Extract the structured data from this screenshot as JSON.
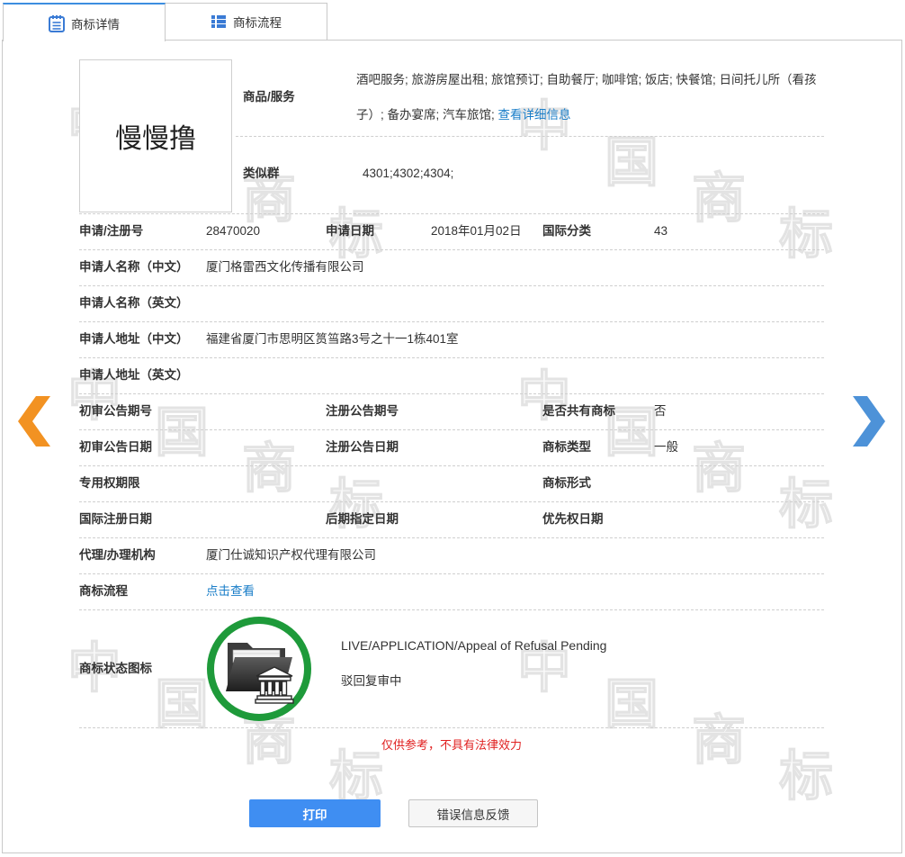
{
  "tabs": [
    {
      "label": "商标详情",
      "icon": "notebook-icon",
      "active": true
    },
    {
      "label": "商标流程",
      "icon": "list-icon",
      "active": false
    }
  ],
  "trademark": {
    "image_text": "慢慢撸"
  },
  "goods_services": {
    "label": "商品/服务",
    "value": "酒吧服务; 旅游房屋出租; 旅馆预订; 自助餐厅; 咖啡馆; 饭店; 快餐馆; 日间托儿所（看孩子）; 备办宴席; 汽车旅馆;",
    "detail_link": "查看详细信息"
  },
  "similar_group": {
    "label": "类似群",
    "value": "4301;4302;4304;"
  },
  "details": {
    "registration_no": {
      "label": "申请/注册号",
      "value": "28470020"
    },
    "application_date": {
      "label": "申请日期",
      "value": "2018年01月02日"
    },
    "international_class": {
      "label": "国际分类",
      "value": "43"
    },
    "applicant_name_cn": {
      "label": "申请人名称（中文）",
      "value": "厦门格雷西文化传播有限公司"
    },
    "applicant_name_en": {
      "label": "申请人名称（英文）"
    },
    "applicant_address_cn": {
      "label": "申请人地址（中文）",
      "value": "福建省厦门市思明区筼筜路3号之十一1栋401室"
    },
    "applicant_address_en": {
      "label": "申请人地址（英文）"
    },
    "preliminary_pub_no": {
      "label": "初审公告期号"
    },
    "registration_pub_no": {
      "label": "注册公告期号"
    },
    "shared_trademark": {
      "label": "是否共有商标",
      "value": "否"
    },
    "preliminary_pub_date": {
      "label": "初审公告日期"
    },
    "registration_pub_date": {
      "label": "注册公告日期"
    },
    "trademark_type": {
      "label": "商标类型",
      "value": "一般"
    },
    "exclusive_right_period": {
      "label": "专用权期限"
    },
    "trademark_form": {
      "label": "商标形式"
    },
    "intl_registration_date": {
      "label": "国际注册日期"
    },
    "later_designation_date": {
      "label": "后期指定日期"
    },
    "priority_date": {
      "label": "优先权日期"
    },
    "agency": {
      "label": "代理/办理机构",
      "value": "厦门仕诚知识产权代理有限公司"
    },
    "process": {
      "label": "商标流程",
      "link": "点击查看"
    }
  },
  "status": {
    "label": "商标状态图标",
    "icon": "folder-bank-icon",
    "text_en": "LIVE/APPLICATION/Appeal of Refusal Pending",
    "text_cn": "驳回复审中"
  },
  "disclaimer": "仅供参考，不具有法律效力",
  "buttons": {
    "print": "打印",
    "feedback": "错误信息反馈"
  },
  "navigation": {
    "prev_icon": "chevron-left-icon",
    "next_icon": "chevron-right-icon"
  },
  "watermark": "中国商标",
  "colors": {
    "accent": "#3c8ee0",
    "link": "#1a7ec8",
    "icon": "#3a7bd5",
    "warning_text": "#e02020",
    "status_ring": "#1e9a3a",
    "prev_arrow": "#f29222",
    "next_arrow": "#4d92d8",
    "print_button": "#3f8ef2"
  }
}
